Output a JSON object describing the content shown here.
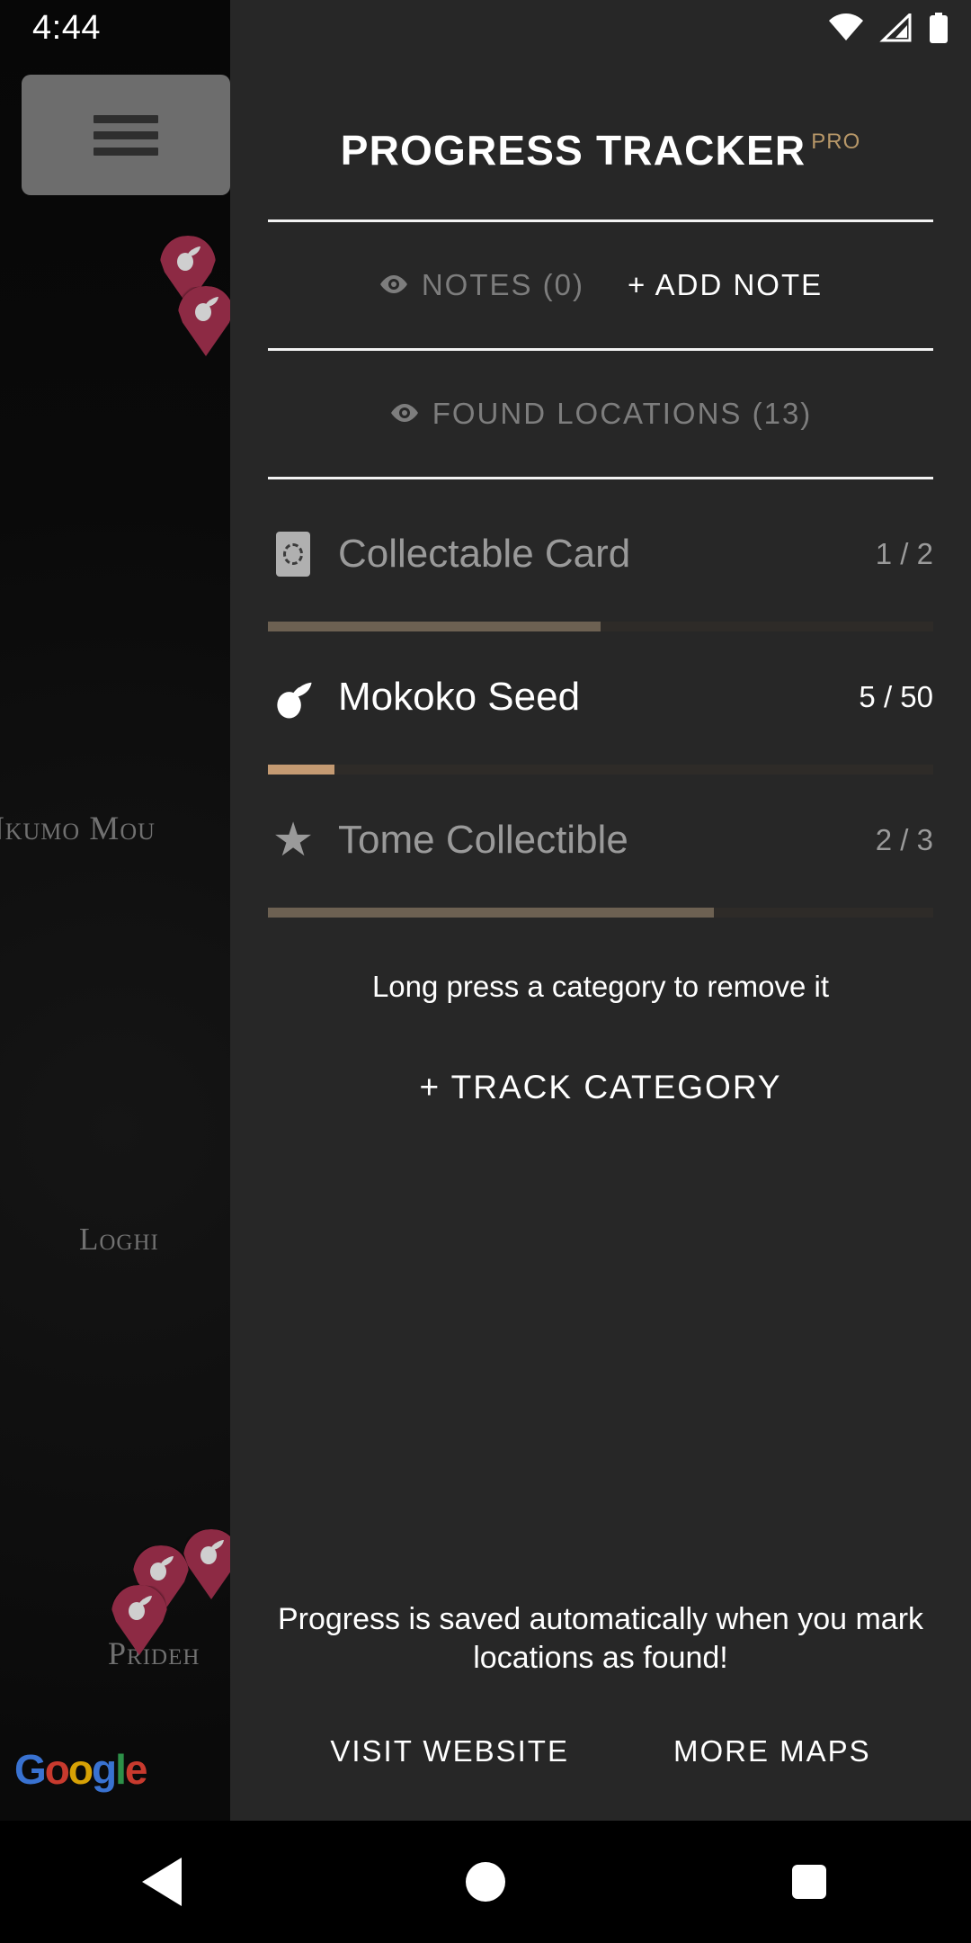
{
  "status_bar": {
    "time": "4:44",
    "icons": [
      "wifi-icon",
      "cellular-signal-icon",
      "battery-icon"
    ]
  },
  "map": {
    "menu_button": "hamburger-menu",
    "labels": [
      {
        "text": "nkumo Mou"
      },
      {
        "text": "Loghi"
      },
      {
        "text": "Prideh"
      }
    ],
    "attribution": {
      "g": "G",
      "o1": "o",
      "o2": "o",
      "g2": "g",
      "l": "l",
      "e": "e"
    },
    "pin_color": "#8d2a44"
  },
  "panel": {
    "title": "PROGRESS TRACKER",
    "pro_badge": "PRO",
    "notes_label": "NOTES (0)",
    "add_note_label": "+ ADD NOTE",
    "found_locations_label": "FOUND LOCATIONS (13)",
    "hint": "Long press a category to remove it",
    "track_category_label": "+ TRACK CATEGORY",
    "accent_color": "#b79768",
    "categories": [
      {
        "icon": "collectable-card-icon",
        "name": "Collectable Card",
        "count": "1 / 2",
        "current": 1,
        "total": 2,
        "percent": 50,
        "active": false,
        "fill_color": "#6d6152"
      },
      {
        "icon": "mokoko-seed-icon",
        "name": "Mokoko Seed",
        "count": "5 / 50",
        "current": 5,
        "total": 50,
        "percent": 10,
        "active": true,
        "fill_color": "#c49a72"
      },
      {
        "icon": "star-icon",
        "name": "Tome Collectible",
        "count": "2 / 3",
        "current": 2,
        "total": 3,
        "percent": 67,
        "active": false,
        "fill_color": "#6d6152"
      }
    ],
    "footer": {
      "save_note": "Progress is saved automatically when you mark locations as found!",
      "visit_website_label": "VISIT WEBSITE",
      "more_maps_label": "MORE MAPS"
    }
  },
  "nav_bar": {
    "back": "back-button",
    "home": "home-button",
    "recents": "recents-button"
  }
}
